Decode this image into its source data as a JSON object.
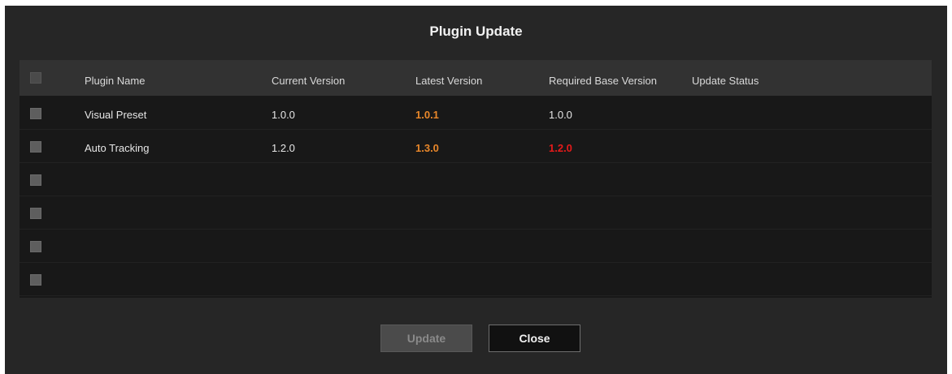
{
  "dialog": {
    "title": "Plugin Update"
  },
  "table": {
    "columns": {
      "name": "Plugin Name",
      "current": "Current Version",
      "latest": "Latest Version",
      "required": "Required Base Version",
      "status": "Update Status"
    },
    "rows": [
      {
        "name": "Visual Preset",
        "current": "1.0.0",
        "latest": "1.0.1",
        "required": "1.0.0",
        "status": ""
      },
      {
        "name": "Auto Tracking",
        "current": "1.2.0",
        "latest": "1.3.0",
        "required": "1.2.0",
        "status": ""
      },
      {
        "name": "",
        "current": "",
        "latest": "",
        "required": "",
        "status": ""
      },
      {
        "name": "",
        "current": "",
        "latest": "",
        "required": "",
        "status": ""
      },
      {
        "name": "",
        "current": "",
        "latest": "",
        "required": "",
        "status": ""
      },
      {
        "name": "",
        "current": "",
        "latest": "",
        "required": "",
        "status": ""
      }
    ]
  },
  "buttons": {
    "update": "Update",
    "close": "Close"
  },
  "colors": {
    "dialog_bg": "#262626",
    "latest_version": "#e8872a",
    "required_warning": "#e61a1a",
    "required_ok": "#e6e6e6"
  }
}
